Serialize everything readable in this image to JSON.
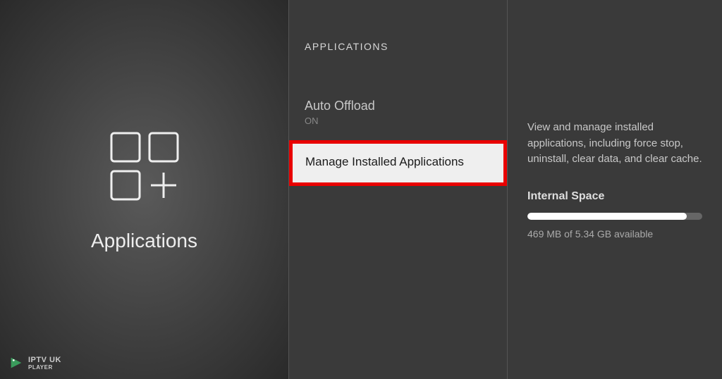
{
  "left": {
    "title": "Applications"
  },
  "watermark": {
    "text": "IPTV UK",
    "subtext": "PLAYER"
  },
  "middle": {
    "header": "APPLICATIONS",
    "items": [
      {
        "title": "Auto Offload",
        "subtitle": "ON"
      },
      {
        "title": "Manage Installed Applications"
      }
    ]
  },
  "right": {
    "description": "View and manage installed applications, including force stop, uninstall, clear data, and clear cache.",
    "storage_title": "Internal Space",
    "storage_text": "469 MB of 5.34 GB available",
    "storage_percent": 91
  }
}
